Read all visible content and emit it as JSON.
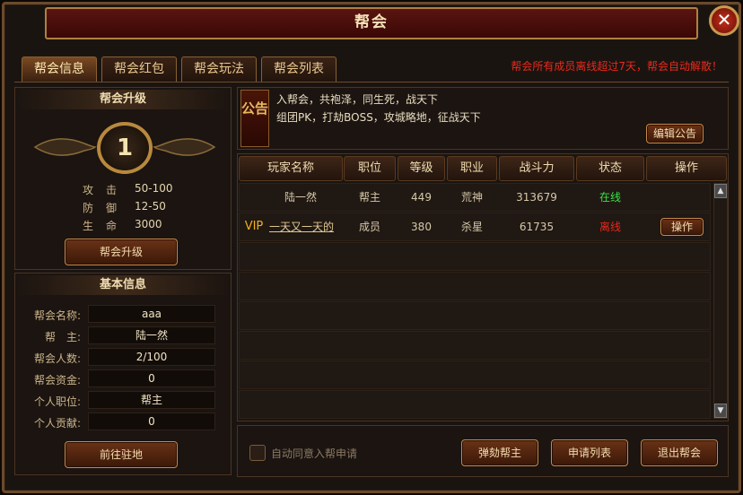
{
  "window": {
    "title": "帮会",
    "close": "✕"
  },
  "tabs": [
    "帮会信息",
    "帮会红包",
    "帮会玩法",
    "帮会列表"
  ],
  "warning": "帮会所有成员离线超过7天，帮会自动解散！",
  "upgrade": {
    "header": "帮会升级",
    "level": "1",
    "stats": [
      {
        "label": "攻击",
        "value": "50-100"
      },
      {
        "label": "防御",
        "value": "12-50"
      },
      {
        "label": "生命",
        "value": "3000"
      }
    ],
    "button": "帮会升级"
  },
  "info": {
    "header": "基本信息",
    "rows": [
      {
        "label": "帮会名称:",
        "value": "aaa"
      },
      {
        "label": "帮　主:",
        "value": "陆一然"
      },
      {
        "label": "帮会人数:",
        "value": "2/100"
      },
      {
        "label": "帮会资金:",
        "value": "0"
      },
      {
        "label": "个人职位:",
        "value": "帮主"
      },
      {
        "label": "个人贡献:",
        "value": "0"
      }
    ],
    "button": "前往驻地"
  },
  "notice": {
    "tag": "公告",
    "lines": [
      "入帮会，共袍泽，同生死，战天下",
      "组团PK，打劫BOSS，攻城略地，征战天下"
    ],
    "edit_button": "编辑公告"
  },
  "table": {
    "headers": [
      "玩家名称",
      "职位",
      "等级",
      "职业",
      "战斗力",
      "状态",
      "操作"
    ],
    "rows": [
      {
        "vip": "",
        "name": "陆一然",
        "position": "帮主",
        "level": "449",
        "class": "荒神",
        "power": "313679",
        "status": "在线",
        "status_color": "#3ee04a",
        "action": ""
      },
      {
        "vip": "VIP",
        "name": "一天又一天的",
        "position": "成员",
        "level": "380",
        "class": "杀星",
        "power": "61735",
        "status": "离线",
        "status_color": "#e8281c",
        "action": "操作"
      }
    ],
    "empty_rows": 6
  },
  "footer": {
    "auto_accept": "自动同意入帮申请",
    "buttons": [
      "弹劾帮主",
      "申请列表",
      "退出帮会"
    ]
  },
  "colors": {
    "accent": "#b8893e",
    "warning": "#e82a1c",
    "online": "#3ee04a",
    "offline": "#e8281c",
    "vip": "#f0b020"
  }
}
